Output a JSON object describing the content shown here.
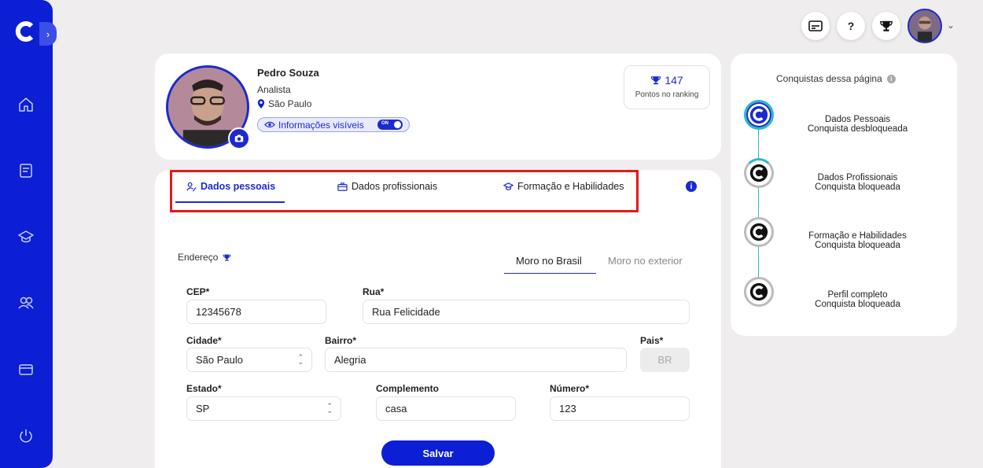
{
  "colors": {
    "accent": "#0c1fd4",
    "highlight": "#e31b1b",
    "timeline": "#2bb8c9"
  },
  "sidebar": {
    "icons": [
      "home-icon",
      "book-icon",
      "graduation-cap-icon",
      "users-icon",
      "card-icon",
      "power-icon"
    ],
    "collapse_glyph": "›"
  },
  "topbar": {
    "help_label": "?",
    "chevron": "⌄"
  },
  "profile": {
    "name": "Pedro Souza",
    "role": "Analista",
    "city": "São Paulo",
    "visibility_label": "Informações visíveis",
    "toggle_label": "ON",
    "points_value": "147",
    "points_label": "Pontos no ranking"
  },
  "tabs": [
    {
      "label": "Dados pessoais",
      "active": true
    },
    {
      "label": "Dados profissionais",
      "active": false
    },
    {
      "label": "Formação e Habilidades",
      "active": false
    }
  ],
  "address": {
    "section_label": "Endereço",
    "location_tabs": [
      "Moro no Brasil",
      "Moro no exterior"
    ],
    "fields": {
      "cep": {
        "label": "CEP*",
        "value": "12345678"
      },
      "rua": {
        "label": "Rua*",
        "value": "Rua Felicidade"
      },
      "cidade": {
        "label": "Cidade*",
        "value": "São Paulo"
      },
      "bairro": {
        "label": "Bairro*",
        "value": "Alegria"
      },
      "pais": {
        "label": "Pais*",
        "value": "BR"
      },
      "estado": {
        "label": "Estado*",
        "value": "SP"
      },
      "complemento": {
        "label": "Complemento",
        "value": "casa"
      },
      "numero": {
        "label": "Número*",
        "value": "123"
      }
    },
    "save_label": "Salvar"
  },
  "achievements": {
    "title": "Conquistas dessa página",
    "items": [
      {
        "name": "Dados Pessoais",
        "status": "Conquista desbloqueada",
        "unlocked": true
      },
      {
        "name": "Dados Profissionais",
        "status": "Conquista bloqueada",
        "unlocked": false
      },
      {
        "name": "Formação e Habilidades",
        "status": "Conquista bloqueada",
        "unlocked": false
      },
      {
        "name": "Perfil completo",
        "status": "Conquista bloqueada",
        "unlocked": false
      }
    ]
  }
}
